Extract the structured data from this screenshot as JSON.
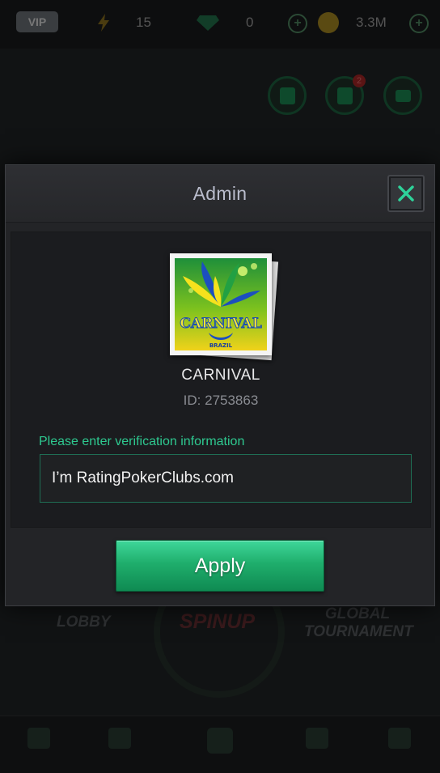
{
  "background": {
    "vip_label": "VIP",
    "energy_count": "15",
    "gem_count": "0",
    "coin_balance": "3.3M",
    "notification_badge": "2",
    "lobby_label": "LOBBY",
    "spinup_label": "SPINUP",
    "global_tournament_label": "GLOBAL TOURNAMENT"
  },
  "modal": {
    "title": "Admin",
    "club": {
      "name": "CARNIVAL",
      "id_text": "ID: 2753863",
      "logo_text": "CARNIVAL",
      "logo_subtext": "BRAZIL"
    },
    "verification": {
      "label": "Please enter verification information",
      "value": "I’m RatingPokerClubs.com"
    },
    "apply_label": "Apply"
  },
  "colors": {
    "accent_green": "#2ec990",
    "button_green": "#1fae6c",
    "modal_bg": "#232427"
  }
}
